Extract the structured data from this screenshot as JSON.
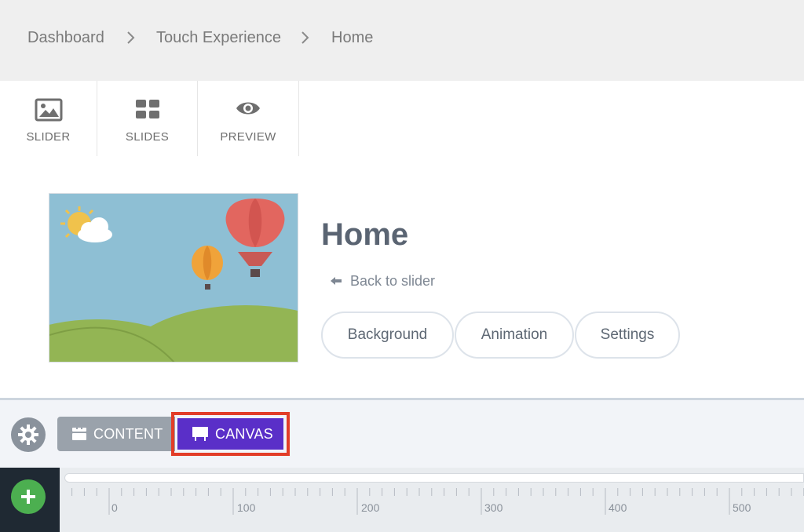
{
  "breadcrumb": {
    "items": [
      "Dashboard",
      "Touch Experience",
      "Home"
    ]
  },
  "toolbar": {
    "items": [
      {
        "label": "SLIDER",
        "icon": "image-icon"
      },
      {
        "label": "SLIDES",
        "icon": "grid-icon"
      },
      {
        "label": "PREVIEW",
        "icon": "eye-icon"
      }
    ]
  },
  "slide": {
    "title": "Home",
    "back_link": "Back to slider",
    "buttons": [
      "Background",
      "Animation",
      "Settings"
    ]
  },
  "panel": {
    "settings_icon": "gear-icon",
    "content_label": "CONTENT",
    "canvas_label": "CANVAS",
    "add_icon": "plus-icon"
  },
  "ruler": {
    "labels": [
      "0",
      "100",
      "200",
      "300",
      "400",
      "500"
    ]
  },
  "colors": {
    "canvas_accent": "#5a2fc8",
    "highlight": "#e23d28",
    "add_green": "#4caf50"
  }
}
